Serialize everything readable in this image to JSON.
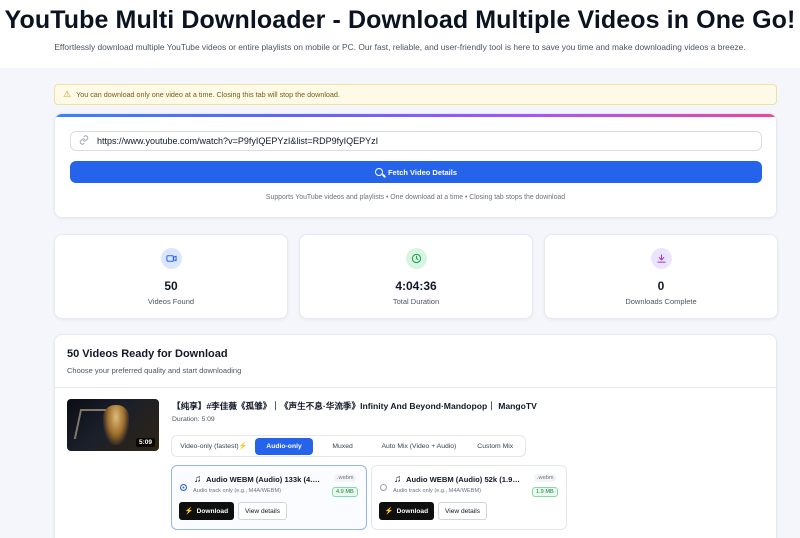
{
  "header": {
    "title": "YouTube Multi Downloader - Download Multiple Videos in One Go!",
    "subtitle": "Effortlessly download multiple YouTube videos or entire playlists on mobile or PC. Our fast, reliable, and user-friendly tool is here to save you time and make downloading videos a breeze."
  },
  "warning": {
    "text": "You can download only one video at a time. Closing this tab will stop the download.",
    "icon": "warning-icon"
  },
  "url_form": {
    "value": "https://www.youtube.com/watch?v=P9fyIQEPYzI&list=RDP9fyIQEPYzI",
    "button_label": "Fetch Video Details",
    "hint": "Supports YouTube videos and playlists • One download at a time • Closing tab stops the download",
    "accent_color": "#2563eb"
  },
  "stats": [
    {
      "value": "50",
      "label": "Videos Found",
      "icon": "video-icon",
      "color": "#2563eb"
    },
    {
      "value": "4:04:36",
      "label": "Total Duration",
      "icon": "clock-icon",
      "color": "#16a34a"
    },
    {
      "value": "0",
      "label": "Downloads Complete",
      "icon": "download-icon",
      "color": "#9333ea"
    }
  ],
  "list": {
    "title": "50 Videos Ready for Download",
    "subtitle": "Choose your preferred quality and start downloading"
  },
  "video": {
    "title": "【纯享】#李佳薇《孤雏》｜《声生不息·华流季》Infinity And Beyond·Mandopop｜ MangoTV",
    "duration_label": "Duration: 5:09",
    "thumb_duration": "5:09",
    "tabs": [
      "Video-only (fastest)⚡",
      "Audio-only",
      "Muxed",
      "Auto Mix (Video + Audio)",
      "Custom Mix"
    ],
    "active_tab": "Audio-only",
    "options": [
      {
        "title": "Audio WEBM (Audio) 133k (4.9 MB)",
        "desc": "Audio track only (e.g., M4A/WEBM)",
        "format": ".webm",
        "size": "4.9 MB",
        "download_label": "Download",
        "details_label": "View details",
        "selected": true
      },
      {
        "title": "Audio WEBM (Audio) 52k (1.9 MB)",
        "desc": "Audio track only (e.g., M4A/WEBM)",
        "format": ".webm",
        "size": "1.9 MB",
        "download_label": "Download",
        "details_label": "View details",
        "selected": false
      }
    ]
  }
}
